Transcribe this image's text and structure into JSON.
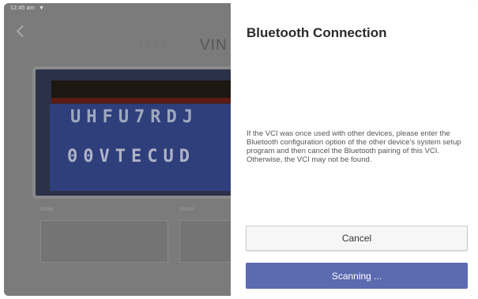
{
  "status_bar": {
    "time": "12:45 am",
    "wifi_icon": "wifi-icon"
  },
  "background": {
    "title": "VIN",
    "plate_text_row1": "UHFU7RDJ",
    "plate_text_row2": "00VTECUD",
    "field_label_1": "Make",
    "field_label_2": "Model"
  },
  "dialog": {
    "title": "Bluetooth Connection",
    "message": "If the VCI was once used with other devices, please enter the Bluetooth configuration option of the other device's system setup program and then cancel the Bluetooth pairing of this VCI. Otherwise, the VCI may not be found.",
    "cancel_label": "Cancel",
    "scanning_label": "Scanning ..."
  },
  "colors": {
    "accent": "#5c6ab0",
    "overlay": "#7b7b7b"
  }
}
